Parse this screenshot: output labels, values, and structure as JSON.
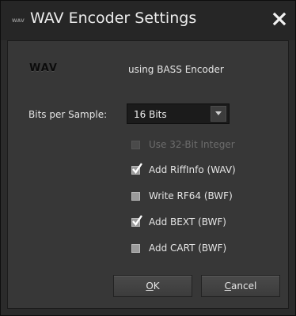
{
  "window": {
    "title": "WAV Encoder Settings",
    "logo_text": "WAV"
  },
  "header": {
    "format_logo": "WAV",
    "encoder_text": "using BASS Encoder"
  },
  "bits": {
    "label": "Bits per Sample:",
    "selected": "16 Bits"
  },
  "options": [
    {
      "label": "Use 32-Bit Integer",
      "checked": false,
      "enabled": false
    },
    {
      "label": "Add RiffInfo (WAV)",
      "checked": true,
      "enabled": true
    },
    {
      "label": "Write RF64 (BWF)",
      "checked": false,
      "enabled": true
    },
    {
      "label": "Add BEXT (BWF)",
      "checked": true,
      "enabled": true
    },
    {
      "label": "Add CART (BWF)",
      "checked": false,
      "enabled": true
    }
  ],
  "buttons": {
    "ok": {
      "mnemonic": "O",
      "rest": "K"
    },
    "cancel": {
      "mnemonic": "C",
      "rest": "ancel"
    }
  },
  "icons": {
    "close": "close-icon",
    "dropdown": "chevron-down-icon",
    "check": "checkmark-icon"
  },
  "colors": {
    "window_bg": "#2b2b2b",
    "panel_bg": "#373737",
    "text": "#e4e4e4",
    "disabled_text": "#6c6c6c"
  }
}
